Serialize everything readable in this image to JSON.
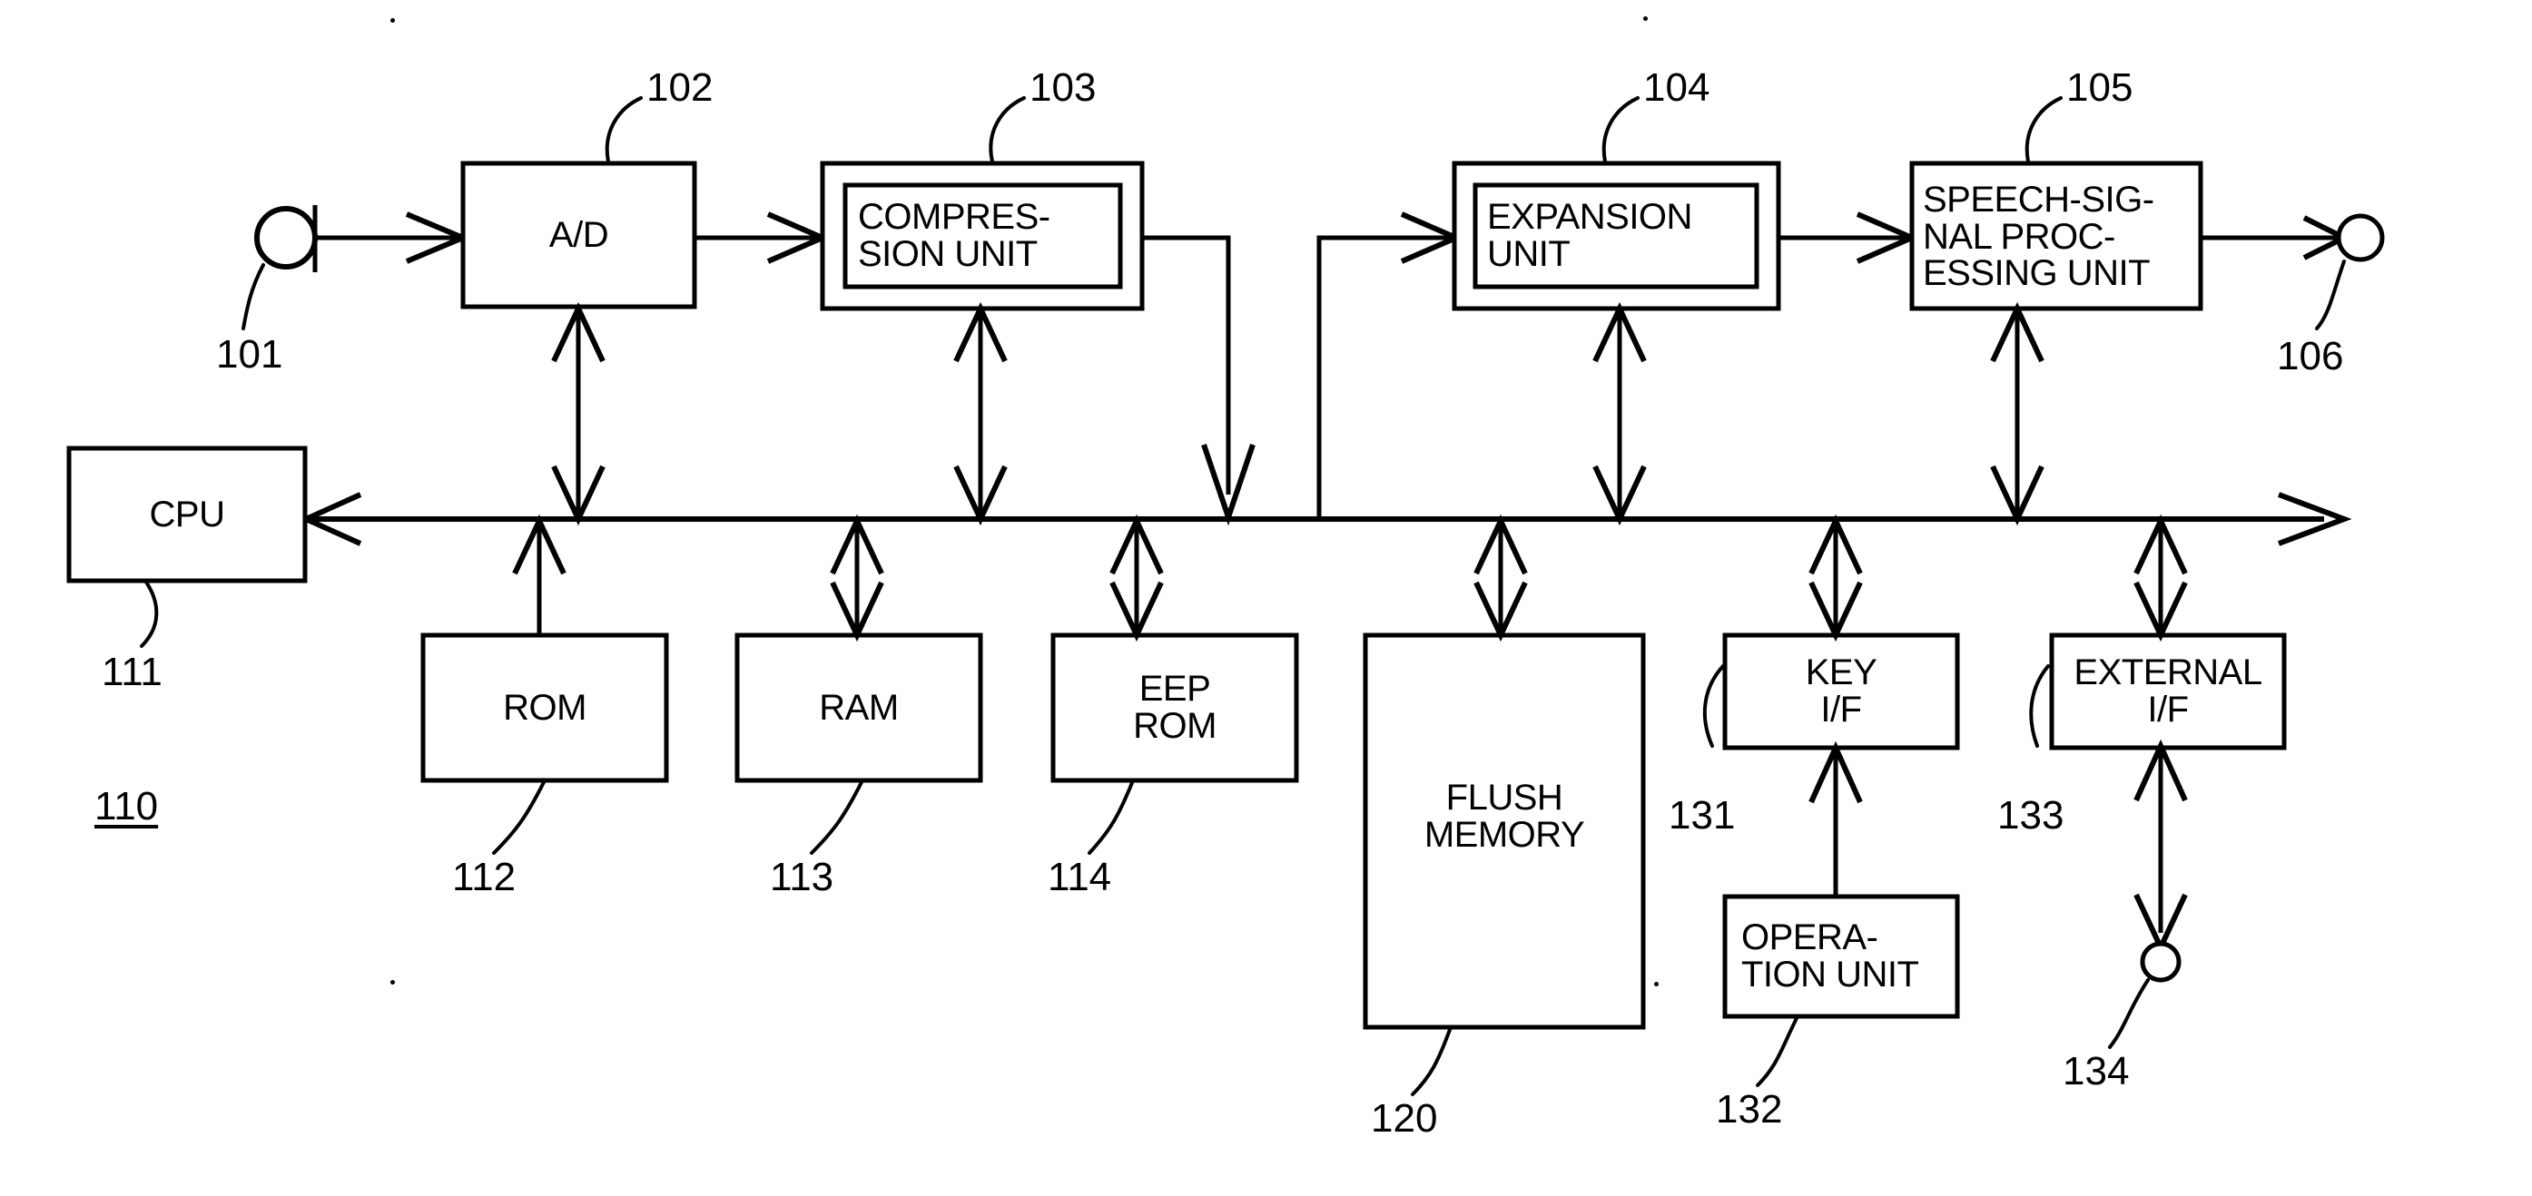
{
  "figure": {
    "kind": "patent-block-diagram",
    "subject": "digital speech recorder block diagram",
    "system_ref": "110"
  },
  "blocks": [
    {
      "id": "ad",
      "label": "A/D",
      "ref": "102",
      "inner_box": false
    },
    {
      "id": "compress",
      "label": "COMPRES-\nSION UNIT",
      "ref": "103",
      "inner_box": true
    },
    {
      "id": "expansion",
      "label": "EXPANSION\nUNIT",
      "ref": "104",
      "inner_box": true
    },
    {
      "id": "speech",
      "label": "SPEECH-SIG-\nNAL PROC-\nESSING UNIT",
      "ref": "105",
      "inner_box": false
    },
    {
      "id": "cpu",
      "label": "CPU",
      "ref": "111",
      "inner_box": false
    },
    {
      "id": "rom",
      "label": "ROM",
      "ref": "112",
      "inner_box": false
    },
    {
      "id": "ram",
      "label": "RAM",
      "ref": "113",
      "inner_box": false
    },
    {
      "id": "eeprom",
      "label": "EEP\nROM",
      "ref": "114",
      "inner_box": false
    },
    {
      "id": "flush",
      "label": "FLUSH\nMEMORY",
      "ref": "120",
      "inner_box": false
    },
    {
      "id": "keyif",
      "label": "KEY\nI/F",
      "ref": "131",
      "inner_box": false
    },
    {
      "id": "operation",
      "label": "OPERA-\nTION UNIT",
      "ref": "132",
      "inner_box": false
    },
    {
      "id": "extif",
      "label": "EXTERNAL\nI/F",
      "ref": "133",
      "inner_box": false
    }
  ],
  "terminals": [
    {
      "id": "mic",
      "ref": "101",
      "kind": "microphone-terminal"
    },
    {
      "id": "speaker",
      "ref": "106",
      "kind": "speaker-terminal"
    },
    {
      "id": "extport",
      "ref": "134",
      "kind": "external-port-terminal"
    }
  ],
  "ref_numbers": {
    "mic": "101",
    "ad": "102",
    "compress": "103",
    "expansion": "104",
    "speech": "105",
    "speaker": "106",
    "system": "110",
    "cpu": "111",
    "rom": "112",
    "ram": "113",
    "eeprom": "114",
    "flush": "120",
    "keyif": "131",
    "operation": "132",
    "extif": "133",
    "extport": "134"
  },
  "labels": {
    "ad": "A/D",
    "compress": "COMPRES-\nSION UNIT",
    "expansion": "EXPANSION\nUNIT",
    "speech": "SPEECH-SIG-\nNAL PROC-\nESSING UNIT",
    "cpu": "CPU",
    "rom": "ROM",
    "ram": "RAM",
    "eeprom": "EEP\nROM",
    "flush": "FLUSH\nMEMORY",
    "keyif": "KEY\nI/F",
    "operation": "OPERA-\nTION UNIT",
    "extif": "EXTERNAL\nI/F"
  },
  "colors": {
    "ink": "#000000",
    "paper": "#ffffff"
  },
  "chart_data": {
    "type": "diagram",
    "title": "",
    "nodes": [
      "101 microphone",
      "102 A/D",
      "103 COMPRESSION UNIT",
      "104 EXPANSION UNIT",
      "105 SPEECH-SIGNAL PROCESSING UNIT",
      "106 speaker",
      "110 system",
      "111 CPU",
      "112 ROM",
      "113 RAM",
      "114 EEP ROM",
      "120 FLUSH MEMORY",
      "131 KEY I/F",
      "132 OPERATION UNIT",
      "133 EXTERNAL I/F",
      "134 external port"
    ],
    "edges": [
      {
        "from": "101",
        "to": "102",
        "arrow": "single"
      },
      {
        "from": "102",
        "to": "103",
        "arrow": "single"
      },
      {
        "from": "103",
        "to": "bus",
        "arrow": "single"
      },
      {
        "from": "bus",
        "to": "104",
        "arrow": "single"
      },
      {
        "from": "104",
        "to": "105",
        "arrow": "single"
      },
      {
        "from": "105",
        "to": "106",
        "arrow": "single"
      },
      {
        "from": "102",
        "to": "bus",
        "arrow": "double"
      },
      {
        "from": "103",
        "to": "bus",
        "arrow": "double"
      },
      {
        "from": "104",
        "to": "bus",
        "arrow": "double"
      },
      {
        "from": "105",
        "to": "bus",
        "arrow": "double"
      },
      {
        "from": "bus",
        "to": "111",
        "arrow": "single"
      },
      {
        "from": "112",
        "to": "bus",
        "arrow": "single"
      },
      {
        "from": "113",
        "to": "bus",
        "arrow": "double"
      },
      {
        "from": "114",
        "to": "bus",
        "arrow": "double"
      },
      {
        "from": "120",
        "to": "bus",
        "arrow": "double"
      },
      {
        "from": "131",
        "to": "bus",
        "arrow": "double"
      },
      {
        "from": "133",
        "to": "bus",
        "arrow": "double"
      },
      {
        "from": "132",
        "to": "131",
        "arrow": "single"
      },
      {
        "from": "133",
        "to": "134",
        "arrow": "double"
      }
    ]
  }
}
